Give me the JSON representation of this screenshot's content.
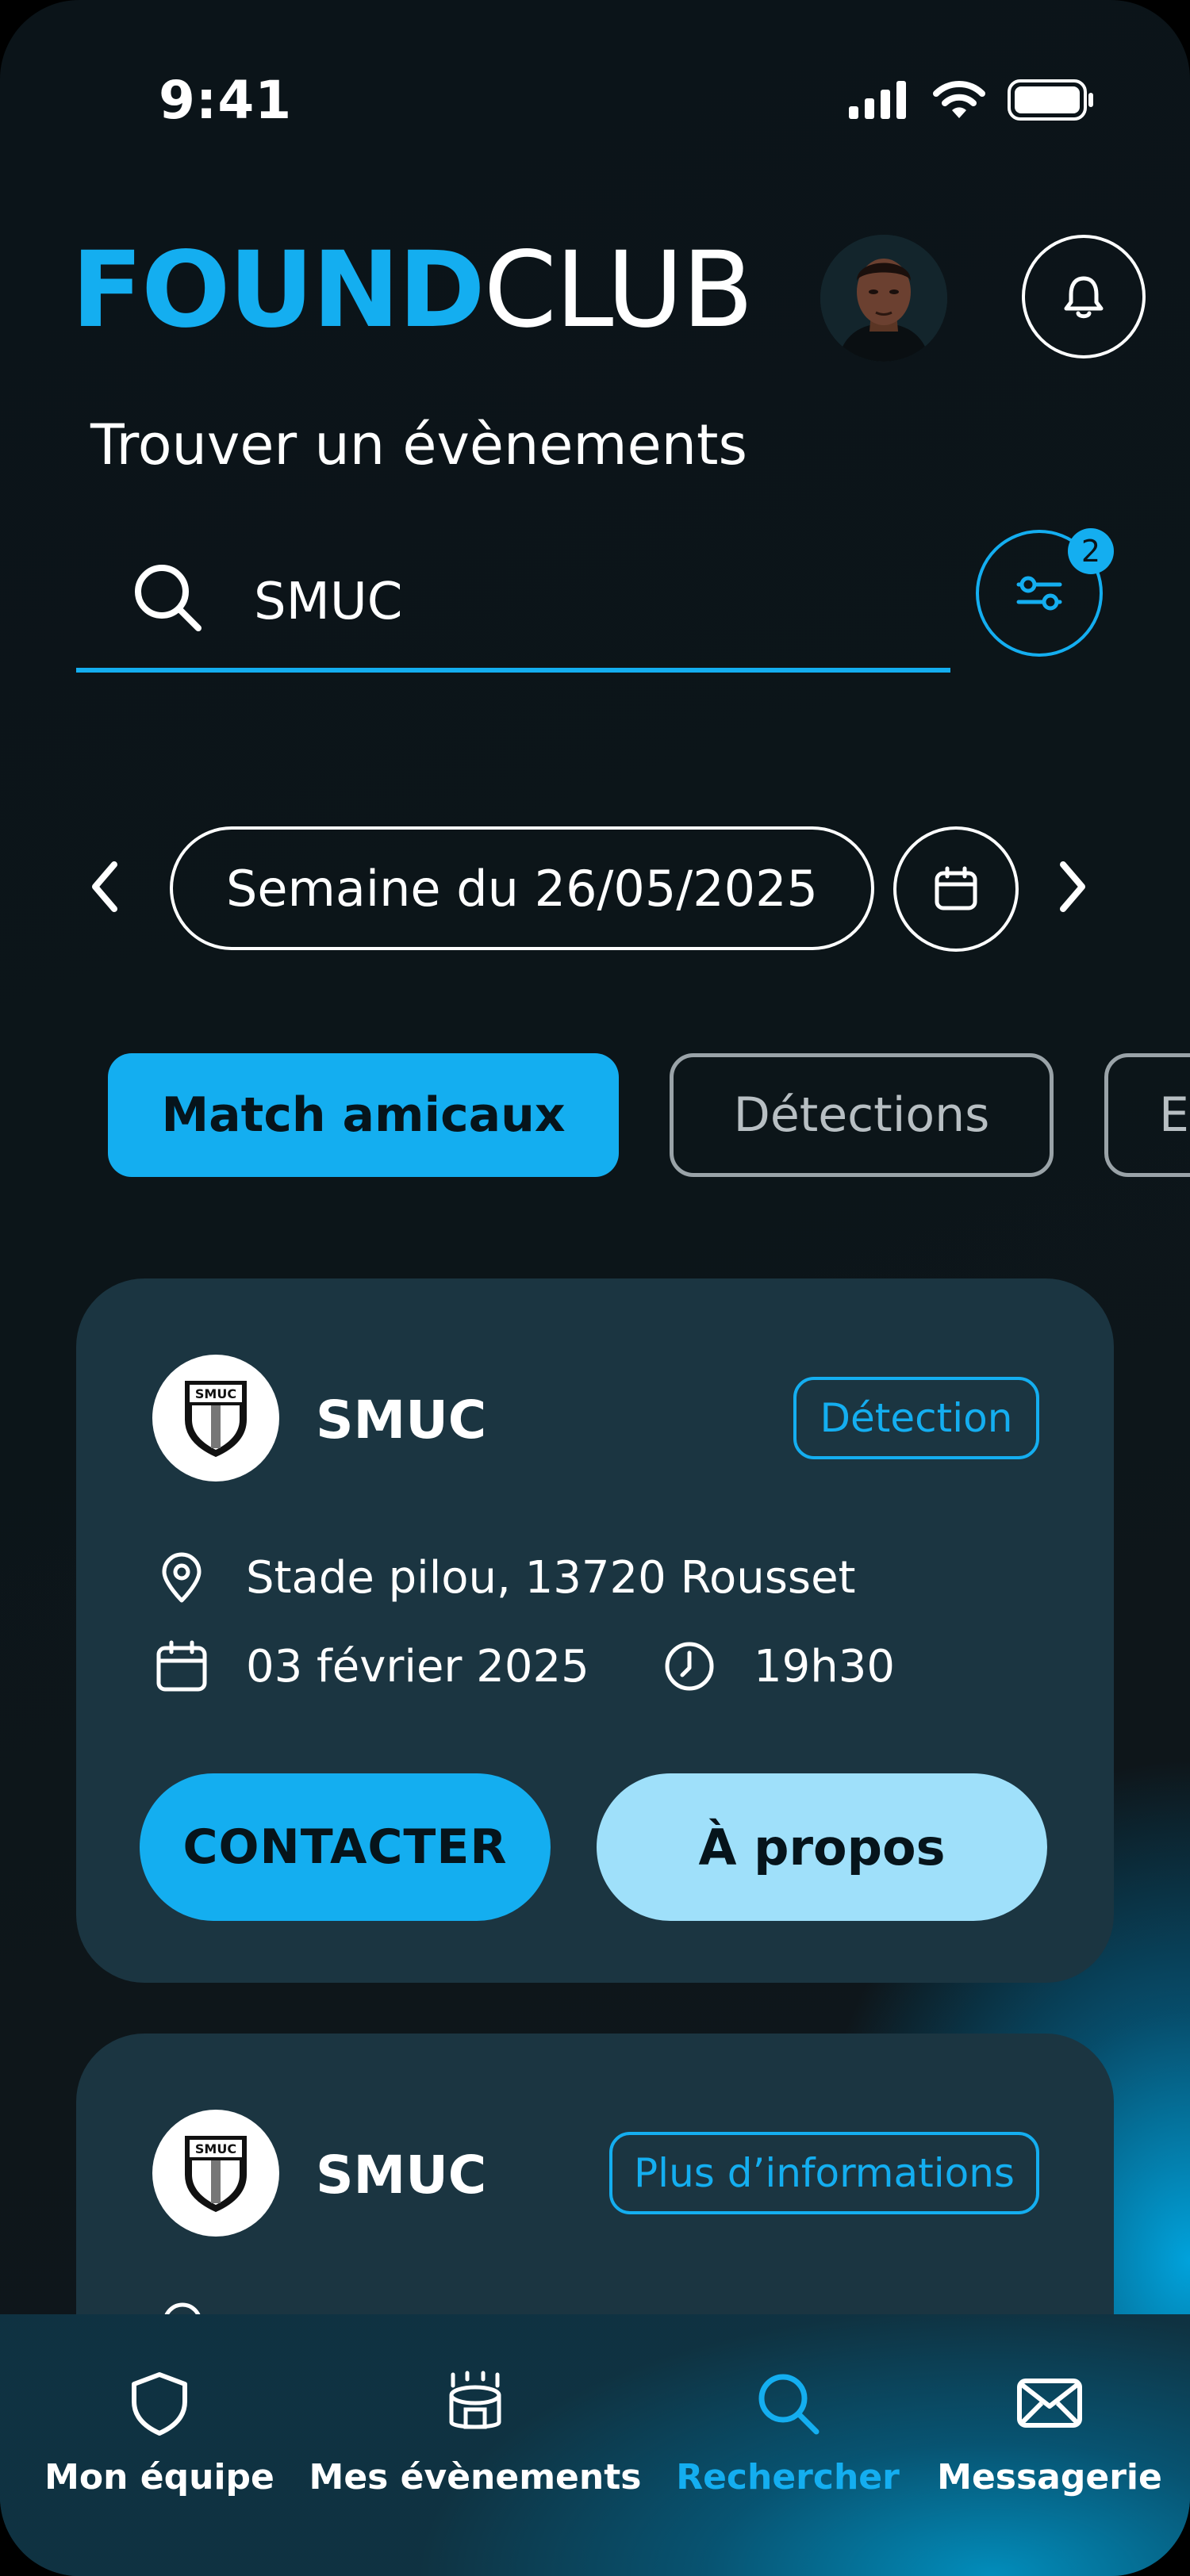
{
  "status_bar": {
    "time": "9:41"
  },
  "header": {
    "logo_part1": "FOUND",
    "logo_part2": "CLUB"
  },
  "page_title": "Trouver un évènements",
  "search": {
    "value": "SMUC",
    "filter_count": "2"
  },
  "week": {
    "label": "Semaine du 26/05/2025"
  },
  "chips": [
    {
      "label": "Match amicaux",
      "active": true
    },
    {
      "label": "Détections",
      "active": false
    },
    {
      "label": "E",
      "active": false
    }
  ],
  "cards": [
    {
      "club": "SMUC",
      "logo_text": "SMUC",
      "tag": "Détection",
      "location": "Stade pilou, 13720 Rousset",
      "date": "03 février 2025",
      "time": "19h30",
      "contact_label": "CONTACTER",
      "about_label": "À propos"
    },
    {
      "club": "SMUC",
      "logo_text": "SMUC",
      "tag": "Plus d’informations"
    }
  ],
  "nav": [
    {
      "label": "Mon équipe",
      "icon": "shield-icon"
    },
    {
      "label": "Mes évènements",
      "icon": "stadium-icon"
    },
    {
      "label": "Rechercher",
      "icon": "search-icon",
      "active": true
    },
    {
      "label": "Messagerie",
      "icon": "mail-icon"
    }
  ],
  "colors": {
    "accent": "#14aef0",
    "card": "#1b3541",
    "background": "#0b1419",
    "light_button": "#9fe0fa"
  }
}
